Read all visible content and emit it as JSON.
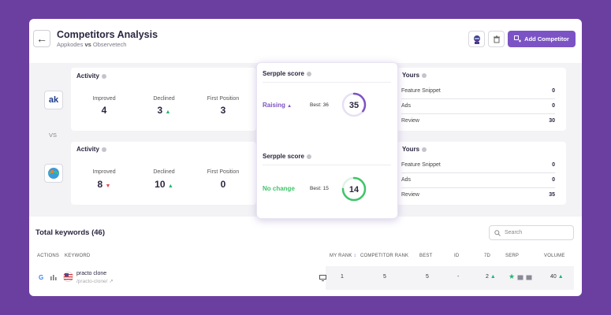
{
  "header": {
    "title": "Competitors Analysis",
    "subtitle_left": "Appkodes",
    "subtitle_vs": "vs",
    "subtitle_right": "Observetech",
    "add_label": "Add Competitor"
  },
  "vs_label": "VS",
  "competitors": [
    {
      "logo_text": "ak",
      "activity_title": "Activity",
      "metrics": [
        {
          "label": "Improved",
          "value": "4",
          "trend": ""
        },
        {
          "label": "Declined",
          "value": "3",
          "trend": "up"
        },
        {
          "label": "First Position",
          "value": "3",
          "trend": ""
        }
      ],
      "score": {
        "title": "Serpple score",
        "status": "Raising",
        "status_arrow": "▲",
        "best": "Best: 36",
        "value": "35",
        "fraction": 0.35,
        "color": "#7c53c4"
      },
      "yours": {
        "title": "Yours",
        "rows": [
          {
            "label": "Feature Snippet",
            "value": "0"
          },
          {
            "label": "Ads",
            "value": "0"
          },
          {
            "label": "Review",
            "value": "30"
          }
        ]
      }
    },
    {
      "logo_text": "",
      "activity_title": "Activity",
      "metrics": [
        {
          "label": "Improved",
          "value": "8",
          "trend": "down"
        },
        {
          "label": "Declined",
          "value": "10",
          "trend": "up"
        },
        {
          "label": "First Position",
          "value": "0",
          "trend": ""
        }
      ],
      "score": {
        "title": "Serpple score",
        "status": "No change",
        "status_arrow": "",
        "best": "Best: 15",
        "value": "14",
        "fraction": 0.75,
        "color": "#3fc46a"
      },
      "yours": {
        "title": "Yours",
        "rows": [
          {
            "label": "Feature Snippet",
            "value": "0"
          },
          {
            "label": "Ads",
            "value": "0"
          },
          {
            "label": "Review",
            "value": "35"
          }
        ]
      }
    }
  ],
  "keywords": {
    "title": "Total keywords (46)",
    "search_placeholder": "Search",
    "columns": [
      "ACTIONS",
      "KEYWORD",
      "MY RANK",
      "COMPETITOR RANK",
      "BEST",
      "ID",
      "7D",
      "SERP",
      "VOLUME"
    ],
    "row": {
      "keyword": "practo clone",
      "url": "/practo-clone/",
      "my_rank": "1",
      "competitor_rank": "5",
      "best": "5",
      "id": "-",
      "d7": "2",
      "volume": "40"
    }
  },
  "colors": {
    "accent": "#7c53c4",
    "green": "#22b573",
    "red": "#e24b4b",
    "background": "#6b3fa0"
  }
}
